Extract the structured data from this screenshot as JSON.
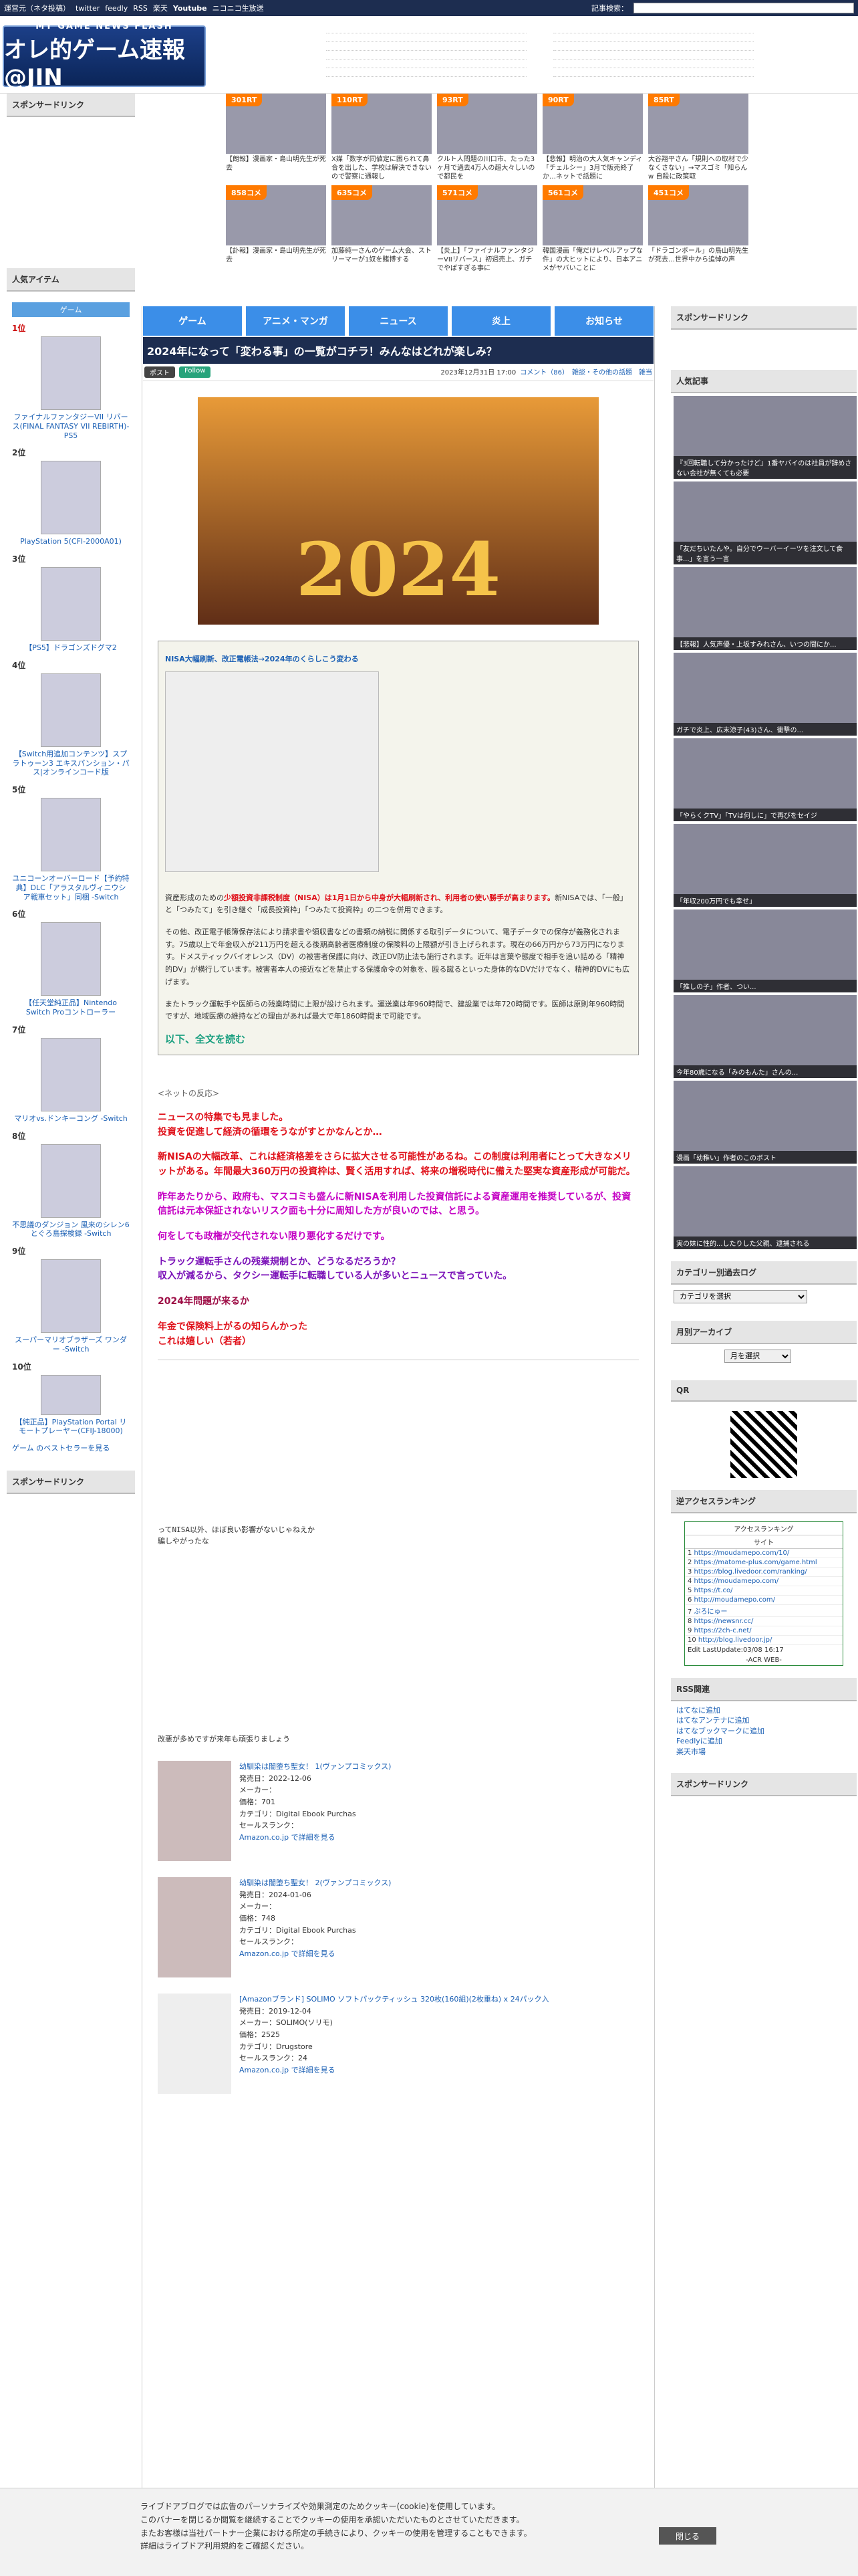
{
  "topbar": {
    "links": [
      "運営元（ネタ投稿）",
      "twitter",
      "feedly",
      "RSS",
      "楽天",
      "Youtube",
      "ニコニコ生放送"
    ],
    "search_label": "記事検索："
  },
  "header": {
    "logo_line1": "MY GAME NEWS FLASH",
    "logo_line2": "オレ的ゲーム速報@JIN"
  },
  "left": {
    "sponsor": "スポンサードリンク",
    "popular": "人気アイテム",
    "tab": "ゲーム",
    "items": [
      {
        "no": "1位",
        "title": "ファイナルファンタジーVII リバース(FINAL FANTASY VII REBIRTH)-PS5"
      },
      {
        "no": "2位",
        "title": "PlayStation 5(CFI-2000A01)"
      },
      {
        "no": "3位",
        "title": "【PS5】ドラゴンズドグマ2"
      },
      {
        "no": "4位",
        "title": "【Switch用追加コンテンツ】スプラトゥーン3 エキスパンション・パス|オンラインコード版"
      },
      {
        "no": "5位",
        "title": "ユニコーンオーバーロード【予約特典】DLC「アラスタルヴィニウシア戦車セット」同梱 -Switch"
      },
      {
        "no": "6位",
        "title": "【任天堂純正品】Nintendo Switch Proコントローラー"
      },
      {
        "no": "7位",
        "title": "マリオvs.ドンキーコング -Switch"
      },
      {
        "no": "8位",
        "title": "不思議のダンジョン 風来のシレン6 とぐろ島探検録 -Switch"
      },
      {
        "no": "9位",
        "title": "スーパーマリオブラザーズ ワンダー -Switch"
      },
      {
        "no": "10位",
        "title": "【純正品】PlayStation Portal リモートプレーヤー(CFIJ-18000)"
      }
    ],
    "more": "ゲーム のベストセラーを見る",
    "sponsor2": "スポンサードリンク"
  },
  "sponsor_grid": [
    {
      "badge": "301RT",
      "cap": "【朗報】漫画家・島山明先生が死去"
    },
    {
      "badge": "110RT",
      "cap": "X媒「数字が同値定に困られて鼻合を出した、学校は解決できないので警察に通報し"
    },
    {
      "badge": "93RT",
      "cap": "クルト人問題の川口市、たった3ヶ月で過去4万人の超大々しいので都民を"
    },
    {
      "badge": "90RT",
      "cap": "【悲報】明治の大人気キャンディ「チェルシー」3月で販売終了か…ネットで話題に"
    },
    {
      "badge": "85RT",
      "cap": "大谷翔平さん「規則への取材で少なくさない」→マスゴミ「知らんw 自殺に政策取"
    },
    {
      "badge": "",
      "cap": ""
    },
    {
      "badge": "858コメ",
      "cap": "【訃報】漫画家・島山明先生が死去"
    },
    {
      "badge": "635コメ",
      "cap": "加藤純一さんのゲーム大会、ストリーマーが1奴を賭博する"
    },
    {
      "badge": "571コメ",
      "cap": "【炎上】「ファイナルファンタジーVIIリバース」初週売上、ガチでやばすぎる事に"
    },
    {
      "badge": "561コメ",
      "cap": "韓国漫画「俺だけレベルアップな件」の大ヒットにより、日本アニメがヤバいことに"
    },
    {
      "badge": "451コメ",
      "cap": "「ドラゴンボール」の鳥山明先生が死去…世界中から追悼の声"
    },
    {
      "badge": "",
      "cap": ""
    }
  ],
  "nav": [
    "ゲーム",
    "アニメ・マンガ",
    "ニュース",
    "炎上",
    "お知らせ"
  ],
  "article": {
    "title": "2024年になって「変わる事」の一覧がコチラ！みんなはどれが楽しみ？",
    "tweet": "ポスト",
    "follow": "Follow",
    "date": "2023年12月31日 17:00",
    "meta": "コメント（86）　雑談・その他の話題　雑当",
    "hero": "2024",
    "quote_head": "NISA大幅刷新、改正電帳法→2024年のくらしこう変わる",
    "p1_red": "少額投資非課税制度（NISA）は1月1日から中身が大幅刷新され、利用者の使い勝手が高まります。",
    "p1_pre": "資産形成のための",
    "p1_rest": "新NISAでは、「一般」と「つみたて」を引き継ぐ「成長投資枠」「つみたて投資枠」の二つを併用できます。",
    "p2": "その他、改正電子帳簿保存法により請求書や領収書などの書類の納税に関係する取引データについて、電子データでの保存が義務化されます。75歳以上で年金収入が211万円を超える後期高齢者医療制度の保険料の上限額が引き上げられます。現在の66万円から73万円になります。ドメスティックバイオレンス（DV）の被害者保護に向け、改正DV防止法も施行されます。近年は言葉や態度で相手を追い詰める「精神的DV」が横行しています。被害者本人の接近などを禁止する保護命令の対象を、殴る蹴るといった身体的なDVだけでなく、精神的DVにも広げます。",
    "p3_pre": "またトラック運転手や医師らの残業時間に上限が設けられます。",
    "p3_rest": "運送業は年960時間で、建設業では年720時間です。医師は原則年960時間ですが、地域医療の維持などの理由があれば最大で年1860時間まで可能です。",
    "more": "以下、全文を読む",
    "reaction_head": "<ネットの反応>",
    "c1": "ニュースの特集でも見ました。\n投資を促進して経済の循環をうながすとかなんとか…",
    "c2": "新NISAの大幅改革、これは経済格差をさらに拡大させる可能性があるね。この制度は利用者にとって大きなメリットがある。年間最大360万円の投資枠は、賢く活用すれば、将来の増税時代に備えた堅実な資産形成が可能だ。",
    "c3": "昨年あたりから、政府も、マスコミも盛んに新NISAを利用した投資信託による資産運用を推奨しているが、投資信託は元本保証されないリスク面も十分に周知した方が良いのでは、と思う。",
    "c3b": "何をしても政権が交代されない限り悪化するだけです。",
    "c4": "トラック運転手さんの残業規制とか、どうなるだろうか？\n収入が減るから、タクシー運転手に転職している人が多いとニュースで言っていた。",
    "c5": "2024年問題が来るか",
    "c6": "年金で保険料上がるの知らんかった\nこれは嬉しい（若者）",
    "aa1_cap": "ってNISA以外、ほぼ良い影響がないじゃねえか\n騙しやがったな",
    "aa2_cap": "改悪が多めですが来年も頑張りましょう",
    "products": [
      {
        "title": "幼馴染は闇堕ち聖女！ 1(ヴァンプコミックス)",
        "date": "発売日：2022-12-06",
        "maker": "メーカー：",
        "price": "価格：701",
        "cat": "カテゴリ：Digital Ebook Purchas",
        "rank": "セールスランク：",
        "link": "Amazon.co.jp で詳細を見る"
      },
      {
        "title": "幼馴染は闇堕ち聖女！ 2(ヴァンプコミックス)",
        "date": "発売日：2024-01-06",
        "maker": "メーカー：",
        "price": "価格：748",
        "cat": "カテゴリ：Digital Ebook Purchas",
        "rank": "セールスランク：",
        "link": "Amazon.co.jp で詳細を見る"
      },
      {
        "title": "[Amazonブランド] SOLIMO ソフトパックティッシュ 320枚(160組)(2枚重ね) x 24パック入",
        "date": "発売日：2019-12-04",
        "maker": "メーカー：SOLIMO(ソリモ)",
        "price": "価格：2525",
        "cat": "カテゴリ：Drugstore",
        "rank": "セールスランク：24",
        "link": "Amazon.co.jp で詳細を見る"
      }
    ]
  },
  "right": {
    "sponsor": "スポンサードリンク",
    "popular": "人気記事",
    "thumbs": [
      "『3回転職して分かったけど』1番ヤバイのは社員が辞めさない会社が無くても必要",
      "「友だちいたんや。自分でウーバーイーツを注文して食事...」を言う一言",
      "【悲報】人気声優・上坂すみれさん、いつの間にか...",
      "ガチで炎上、広末涼子(43)さん、衝撃の...",
      "「やらくクTV」「TVは何しに」で再びをセイジ",
      "「年収200万円でも幸せ」",
      "「推しの子」作者、つい...",
      "今年80歳になる「みのもんた」さんの...",
      "漫画「幼稚い」作者のこのボスト",
      "実の妹に性的...したりした父親、逮捕される"
    ],
    "cat_log": "カテゴリー別過去ログ",
    "cat_select": "カテゴリを選択",
    "archive": "月別アーカイブ",
    "archive_select": "月を選択",
    "qr": "QR",
    "acr": "逆アクセスランキング",
    "acr_head": "アクセスランキング",
    "acr_sub": "サイト",
    "acr_items": [
      "https://moudamepo.com/10/",
      "https://matome-plus.com/game.html",
      "https://blog.livedoor.com/ranking/",
      "https://moudamepo.com/",
      "https://t.co/",
      "http://moudamepo.com/",
      "ぷろにゅー",
      "https://newsnr.cc/",
      "https://2ch-c.net/",
      "http://blog.livedoor.jp/"
    ],
    "acr_edit": "Edit LastUpdate:03/08 16:17",
    "acr_foot": "-ACR WEB-",
    "rss": "RSS関連",
    "rss_links": [
      "はてなに追加",
      "はてなアンテナに追加",
      "はてなブックマークに追加",
      "Feedlyに追加",
      "楽天市場"
    ],
    "sponsor2": "スポンサードリンク"
  },
  "cookie": {
    "l1": "ライブドアブログでは広告のパーソナライズや効果測定のためクッキー(cookie)を使用しています。",
    "l2": "このバナーを閉じるか閲覧を継続することでクッキーの使用を承認いただいたものとさせていただきます。",
    "l3": "またお客様は当社パートナー企業における所定の手続きにより、クッキーの使用を管理することもできます。",
    "l4": "詳細はライブドア利用規約をご確認ください。",
    "close": "閉じる"
  }
}
